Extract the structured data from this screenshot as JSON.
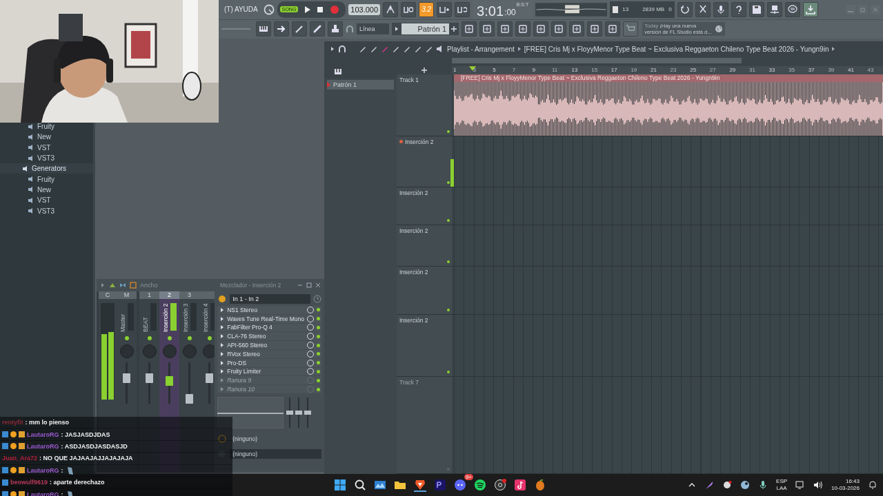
{
  "toolbar": {
    "menu": "(T) AYUDA",
    "mode": "SONG",
    "tempo": "103.000",
    "countdown": "3.2",
    "time": "3:01",
    "time_small": ":00",
    "time_label": "B:S:T",
    "cpu": "13",
    "memory": "2839 MB",
    "polyphony": "0",
    "snap": "Línea",
    "pattern": "Patrón 1",
    "hint_label": "Today",
    "hint": "¡Hay una nueva versión de FL Studio está d..."
  },
  "browser": {
    "items": [
      {
        "kind": "leaf",
        "label": "Fruity"
      },
      {
        "kind": "leaf",
        "label": "New"
      },
      {
        "kind": "leaf",
        "label": "VST"
      },
      {
        "kind": "leaf",
        "label": "VST3"
      },
      {
        "kind": "folder",
        "label": "Generators",
        "expanded": true,
        "children": [
          {
            "label": "Fruity"
          },
          {
            "label": "New"
          },
          {
            "label": "VST"
          },
          {
            "label": "VST3"
          }
        ]
      }
    ]
  },
  "playlist": {
    "title": "Playlist - Arrangement",
    "song": "[FREE] Cris Mj x FloyyMenor Type Beat ~ Exclusiva  Reggaeton Chileno Type Beat 2026 - Yungn9in",
    "patterns": [
      {
        "label": "Patrón 1",
        "selected": true
      }
    ],
    "ruler": [
      "1",
      "3",
      "5",
      "7",
      "9",
      "11",
      "13",
      "15",
      "17",
      "19",
      "21",
      "23",
      "25",
      "27",
      "29",
      "31",
      "33",
      "35",
      "37",
      "39",
      "41",
      "43"
    ],
    "tracks": [
      {
        "name": "Track 1",
        "kind": "audio",
        "clip": "[FREE] Cris Mj x FloyyMenor Type Beat ~ Exclusiva  Reggaeton Chileno Type Beat 2026 - Yungn9in",
        "disabled": false
      },
      {
        "name": "Inserción 2",
        "kind": "insert",
        "disabled": false
      },
      {
        "name": "Inserción 2",
        "kind": "empty",
        "disabled": false
      },
      {
        "name": "Inserción 2",
        "kind": "empty",
        "disabled": false
      },
      {
        "name": "Inserción 2",
        "kind": "empty",
        "disabled": false
      },
      {
        "name": "Inserción 2",
        "kind": "empty",
        "disabled": false
      },
      {
        "name": "Track 7",
        "kind": "empty",
        "disabled": true
      }
    ]
  },
  "mixer": {
    "panel_label": "Ancho",
    "title": "Mezclador - Inserción 2",
    "meter": {
      "level": 0.68
    },
    "meter_header": "C",
    "strips": [
      {
        "header": "M",
        "name": "Master",
        "selected": false,
        "level": 0.62
      },
      {
        "header": "1",
        "name": "BEAT",
        "selected": false,
        "level": 0.62
      },
      {
        "header": "2",
        "name": "Inserción 2",
        "selected": true,
        "level": 0.55
      },
      {
        "header": "3",
        "name": "Inserción 3",
        "selected": false,
        "level": 0.12
      },
      {
        "name": "Inserción 4",
        "selected": false,
        "level": 0.62
      }
    ],
    "input": "In 1 - In 2",
    "slots": [
      {
        "name": "NS1 Stereo",
        "disabled": false
      },
      {
        "name": "Waves Tune Real-Time Mono",
        "disabled": false
      },
      {
        "name": "FabFilter Pro-Q 4",
        "disabled": false
      },
      {
        "name": "CLA-76 Stereo",
        "disabled": false
      },
      {
        "name": "API-560 Stereo",
        "disabled": false
      },
      {
        "name": "RVox Stereo",
        "disabled": false
      },
      {
        "name": "Pro-DS",
        "disabled": false
      },
      {
        "name": "Fruity Limiter",
        "disabled": false
      },
      {
        "name": "Ranura 9",
        "disabled": true
      },
      {
        "name": "Ranura 10",
        "disabled": true
      }
    ],
    "eq": [
      {
        "level": 0.5
      },
      {
        "level": 0.5
      },
      {
        "level": 0.5
      }
    ],
    "outputs": [
      "(ninguno)",
      "(ninguno)"
    ]
  },
  "chat": [
    {
      "user": "rentyfit",
      "color": "#8a2a3a",
      "text": ": mm lo pienso",
      "kind": "text"
    },
    {
      "user": "LautaroRG",
      "color": "#9b59d0",
      "badges": [
        {
          "kind": "prime"
        },
        {
          "kind": "bits"
        },
        {
          "kind": "crown"
        }
      ],
      "text": ": JASJASDJDAS",
      "kind": "text"
    },
    {
      "user": "LautaroRG",
      "color": "#9b59d0",
      "badges": [
        {
          "kind": "prime"
        },
        {
          "kind": "bits"
        },
        {
          "kind": "crown"
        }
      ],
      "text": ": ASDJASDJASDASJD",
      "kind": "text"
    },
    {
      "user": "Juan_Ara72",
      "color": "#b0203a",
      "text": ": NO QUE JAJAAJAJJAJAJAJA",
      "kind": "text"
    },
    {
      "user": "LautaroRG",
      "color": "#9b59d0",
      "badges": [
        {
          "kind": "prime"
        },
        {
          "kind": "bits"
        },
        {
          "kind": "crown"
        }
      ],
      "text": ":",
      "kind": "emote"
    },
    {
      "user": "beowulf9619",
      "color": "#b83a5a",
      "badges": [
        {
          "kind": "prime"
        }
      ],
      "text": ": aparte derechazo",
      "kind": "text"
    },
    {
      "user": "LautaroRG",
      "color": "#9b59d0",
      "badges": [
        {
          "kind": "prime"
        },
        {
          "kind": "bits"
        },
        {
          "kind": "crown"
        }
      ],
      "text": ":",
      "kind": "emote"
    }
  ],
  "taskbar": {
    "lang": "ESP",
    "layout": "LAA",
    "time": "16:43",
    "date": "10-03-2026",
    "discord_badge": "9+"
  }
}
